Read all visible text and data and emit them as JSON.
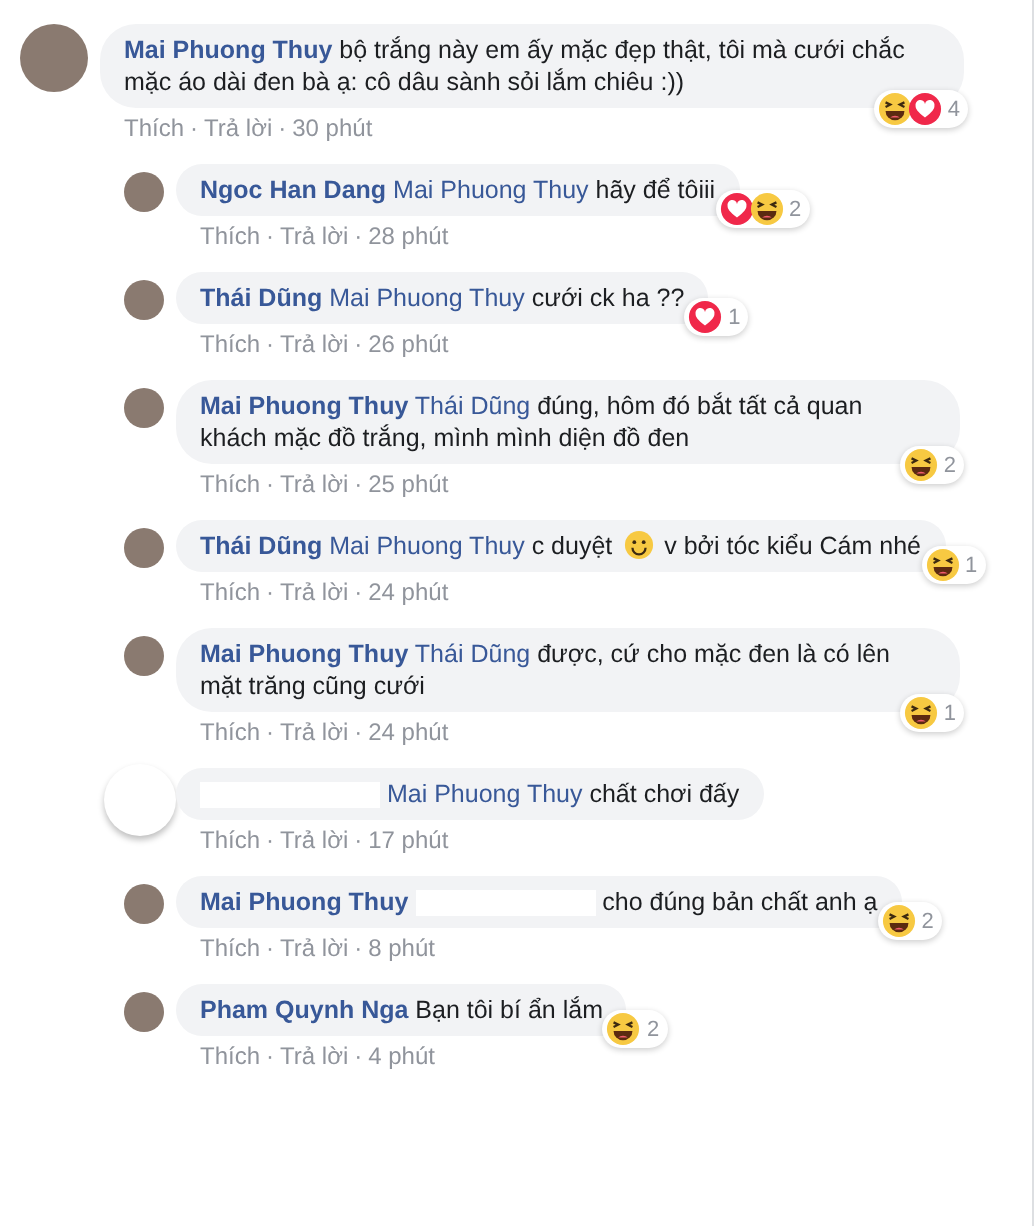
{
  "comment": {
    "blank_avatar": false,
    "author": "Mai Phuong Thuy",
    "text": [
      {
        "kind": "text",
        "text": "bộ trắng này em ấy mặc đẹp thật, tôi mà cưới chắc mặc áo dài đen bà ạ: cô dâu sành sỏi lắm chiêu :))"
      }
    ],
    "reactions": [
      {
        "kind": "haha"
      },
      {
        "kind": "love"
      }
    ],
    "reaction_count": "4",
    "actions": [
      "Thích",
      "Trả lời"
    ],
    "separators": [
      "·",
      "·"
    ],
    "time": "30 phút",
    "replies": [
      {
        "blank_avatar": false,
        "author": "Ngoc Han Dang",
        "mention": "Mai Phuong Thuy",
        "text": [
          {
            "kind": "text",
            "text": "hãy để tôiii"
          }
        ],
        "reactions": [
          {
            "kind": "love"
          },
          {
            "kind": "haha"
          }
        ],
        "reaction_count": "2",
        "actions": [
          "Thích",
          "Trả lời"
        ],
        "separators": [
          "·",
          "·"
        ],
        "time": "28 phút"
      },
      {
        "blank_avatar": false,
        "author": "Thái Dũng",
        "mention": "Mai Phuong Thuy",
        "text": [
          {
            "kind": "text",
            "text": "cưới ck ha ??"
          }
        ],
        "reactions": [
          {
            "kind": "love"
          }
        ],
        "reaction_count": "1",
        "actions": [
          "Thích",
          "Trả lời"
        ],
        "separators": [
          "·",
          "·"
        ],
        "time": "26 phút"
      },
      {
        "blank_avatar": false,
        "author": "Mai Phuong Thuy",
        "mention": "Thái Dũng",
        "text": [
          {
            "kind": "text",
            "text": "đúng, hôm đó bắt tất cả quan khách mặc đồ trắng, mình mình diện đồ đen"
          }
        ],
        "reactions": [
          {
            "kind": "haha"
          }
        ],
        "reaction_count": "2",
        "actions": [
          "Thích",
          "Trả lời"
        ],
        "separators": [
          "·",
          "·"
        ],
        "time": "25 phút"
      },
      {
        "blank_avatar": false,
        "author": "Thái Dũng",
        "mention": "Mai Phuong Thuy",
        "text": [
          {
            "kind": "text",
            "text": "c duyệt"
          },
          {
            "kind": "smiley"
          },
          {
            "kind": "text",
            "text": "v bởi tóc kiểu Cám nhé"
          }
        ],
        "reactions": [
          {
            "kind": "haha"
          }
        ],
        "reaction_count": "1",
        "actions": [
          "Thích",
          "Trả lời"
        ],
        "separators": [
          "·",
          "·"
        ],
        "time": "24 phút"
      },
      {
        "blank_avatar": false,
        "author": "Mai Phuong Thuy",
        "mention": "Thái Dũng",
        "text": [
          {
            "kind": "text",
            "text": "được, cứ cho mặc đen là có lên mặt trăng cũng cưới"
          }
        ],
        "reactions": [
          {
            "kind": "haha"
          }
        ],
        "reaction_count": "1",
        "actions": [
          "Thích",
          "Trả lời"
        ],
        "separators": [
          "·",
          "·"
        ],
        "time": "24 phút"
      },
      {
        "blank_avatar": true,
        "author_redacted": true,
        "mention": "Mai Phuong Thuy",
        "text": [
          {
            "kind": "text",
            "text": "chất chơi đấy"
          }
        ],
        "actions": [
          "Thích",
          "Trả lời"
        ],
        "separators": [
          "·",
          "·"
        ],
        "time": "17 phút"
      },
      {
        "blank_avatar": false,
        "author": "Mai Phuong Thuy",
        "mention_redacted": true,
        "text": [
          {
            "kind": "text",
            "text": "cho đúng bản chất anh ạ"
          }
        ],
        "reactions": [
          {
            "kind": "haha"
          }
        ],
        "reaction_count": "2",
        "actions": [
          "Thích",
          "Trả lời"
        ],
        "separators": [
          "·",
          "·"
        ],
        "time": "8 phút"
      },
      {
        "blank_avatar": false,
        "author": "Pham Quynh Nga",
        "text": [
          {
            "kind": "text",
            "text": "Bạn tôi bí ẩn lắm"
          }
        ],
        "reactions": [
          {
            "kind": "haha"
          }
        ],
        "reaction_count": "2",
        "actions": [
          "Thích",
          "Trả lời"
        ],
        "separators": [
          "·",
          "·"
        ],
        "time": "4 phút"
      }
    ]
  }
}
